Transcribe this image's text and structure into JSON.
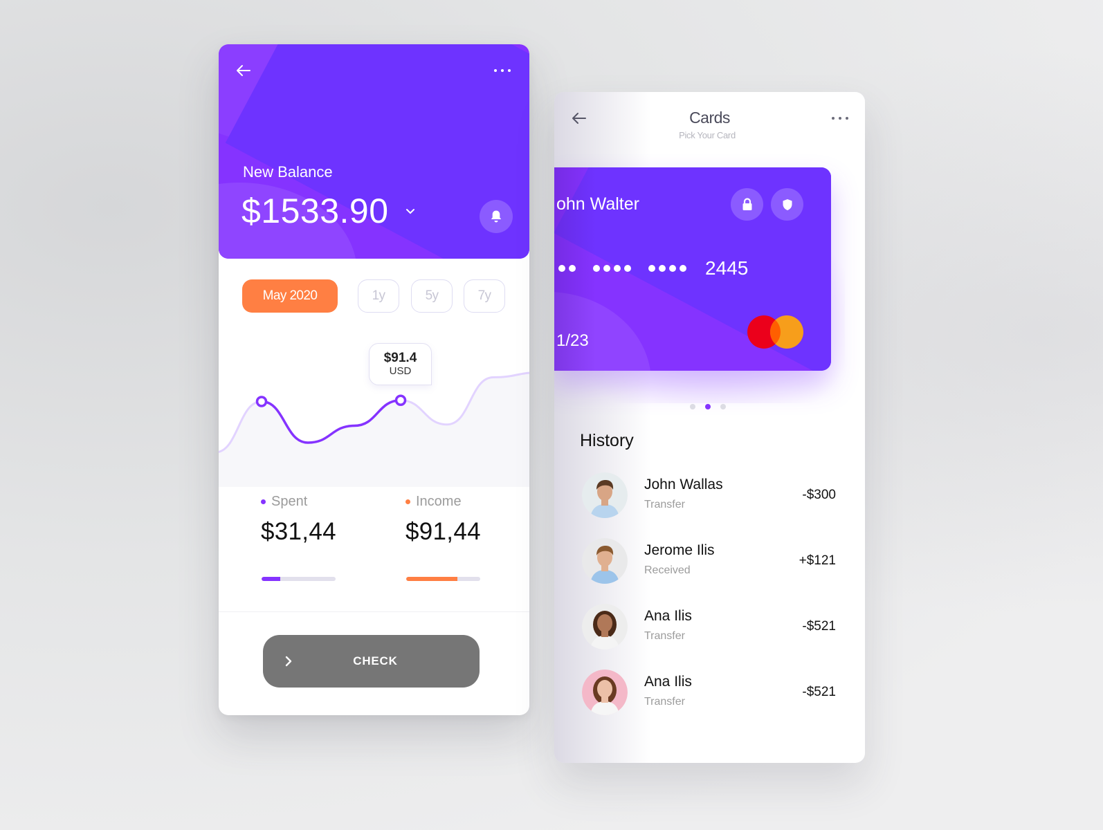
{
  "balance_screen": {
    "back_icon": "arrow-left-icon",
    "more_icon": "more-horizontal-icon",
    "balance_label": "New Balance",
    "balance_amount": "$1533.90",
    "balance_dropdown_icon": "chevron-down-icon",
    "notification_icon": "bell-icon",
    "ranges": [
      {
        "label": "May 2020",
        "active": true
      },
      {
        "label": "1y",
        "active": false
      },
      {
        "label": "5y",
        "active": false
      },
      {
        "label": "7y",
        "active": false
      }
    ],
    "tooltip": {
      "value": "$91.4",
      "unit": "USD"
    },
    "stats": {
      "spent": {
        "label": "Spent",
        "value": "$31,44",
        "progress": 0.25,
        "color": "#8533ff"
      },
      "income": {
        "label": "Income",
        "value": "$91,44",
        "progress": 0.69,
        "color": "#ff7f43"
      }
    },
    "check_button": {
      "label": "CHECK",
      "icon": "chevron-right-icon"
    }
  },
  "chart_data": {
    "type": "line",
    "title": "",
    "xlabel": "",
    "ylabel": "",
    "grid": false,
    "x": [
      0,
      1,
      2,
      3,
      4,
      5,
      6,
      7
    ],
    "series": [
      {
        "name": "background-trend",
        "values": [
          20,
          62,
          28,
          42,
          63,
          43,
          82,
          86
        ]
      },
      {
        "name": "selected-period",
        "x_range": [
          1,
          5
        ],
        "values": [
          62,
          28,
          42,
          63
        ]
      }
    ],
    "highlighted_points": [
      {
        "x": 1,
        "y": 62
      },
      {
        "x": 4,
        "y": 63,
        "label": "$91.4 USD"
      }
    ],
    "ylim": [
      0,
      100
    ]
  },
  "cards_screen": {
    "back_icon": "arrow-left-icon",
    "more_icon": "more-horizontal-icon",
    "title": "Cards",
    "subtitle": "Pick Your Card",
    "card": {
      "holder": "ohn Walter",
      "number_masked_groups": [
        2,
        4,
        4
      ],
      "last4": "2445",
      "expiry": "1/23",
      "lock_icon": "lock-icon",
      "shield_icon": "shield-icon",
      "brand": "mastercard",
      "brand_colors": {
        "left": "#eb001b",
        "right": "#f79e1b",
        "overlap": "#ff5f00"
      }
    },
    "pager": {
      "count": 3,
      "active": 1
    },
    "history_title": "History",
    "history": [
      {
        "name": "John Wallas",
        "type": "Transfer",
        "amount": "-$300",
        "avatar_bg": "#e6ecee",
        "skin": "#d8a585",
        "hair": "#5a3a24",
        "shirt": "#b8d4ee"
      },
      {
        "name": "Jerome Ilis",
        "type": "Received",
        "amount": "+$121",
        "avatar_bg": "#e9e9ea",
        "skin": "#e0b090",
        "hair": "#8a5a30",
        "shirt": "#9cc4ea"
      },
      {
        "name": "Ana Ilis",
        "type": "Transfer",
        "amount": "-$521",
        "avatar_bg": "#ededed",
        "skin": "#b07858",
        "hair": "#4a2a18",
        "shirt": "#f4f4f4"
      },
      {
        "name": "Ana Ilis",
        "type": "Transfer",
        "amount": "-$521",
        "avatar_bg": "#f4b8c8",
        "skin": "#ecc0a8",
        "hair": "#6a3a22",
        "shirt": "#f6f6f6"
      }
    ]
  },
  "colors": {
    "primary": "#8533ff",
    "primary_dark": "#6e33ff",
    "accent": "#ff7f43",
    "button_gray": "#767676"
  }
}
